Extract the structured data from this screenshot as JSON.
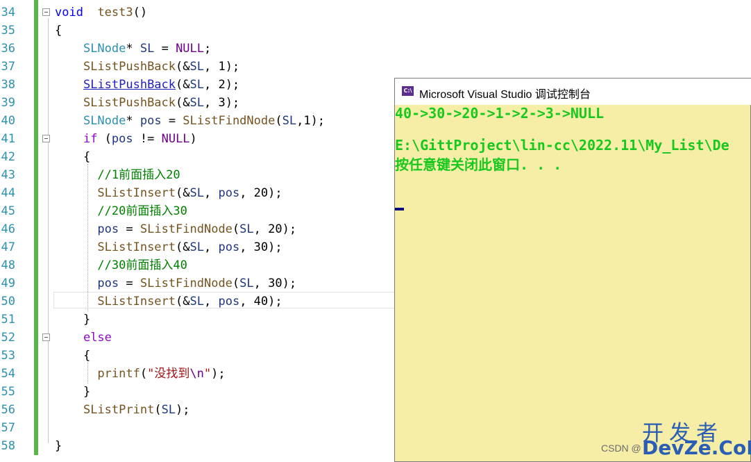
{
  "editor": {
    "lines": [
      {
        "num": "34",
        "parts": [
          [
            "kw",
            "void"
          ],
          [
            "",
            "  "
          ],
          [
            "fn",
            "test3"
          ],
          [
            "",
            "()"
          ]
        ]
      },
      {
        "num": "35",
        "parts": [
          [
            "",
            "{"
          ]
        ]
      },
      {
        "num": "36",
        "parts": [
          [
            "",
            "    "
          ],
          [
            "ty",
            "SLNode"
          ],
          [
            "",
            "* "
          ],
          [
            "var",
            "SL"
          ],
          [
            "",
            " = "
          ],
          [
            "mac",
            "NULL"
          ],
          [
            "",
            ";"
          ]
        ]
      },
      {
        "num": "37",
        "parts": [
          [
            "",
            "    "
          ],
          [
            "fn",
            "SListPushBack"
          ],
          [
            "",
            "(&"
          ],
          [
            "var",
            "SL"
          ],
          [
            "",
            ", 1);"
          ]
        ]
      },
      {
        "num": "38",
        "parts": [
          [
            "",
            "    "
          ],
          [
            "link",
            "SListPushBack"
          ],
          [
            "",
            "(&"
          ],
          [
            "var",
            "SL"
          ],
          [
            "",
            ", 2);"
          ]
        ]
      },
      {
        "num": "39",
        "parts": [
          [
            "",
            "    "
          ],
          [
            "fn",
            "SListPushBack"
          ],
          [
            "",
            "(&"
          ],
          [
            "var",
            "SL"
          ],
          [
            "",
            ", 3);"
          ]
        ]
      },
      {
        "num": "40",
        "parts": [
          [
            "",
            "    "
          ],
          [
            "ty",
            "SLNode"
          ],
          [
            "",
            "* "
          ],
          [
            "var",
            "pos"
          ],
          [
            "",
            " = "
          ],
          [
            "fn",
            "SListFindNode"
          ],
          [
            "",
            "("
          ],
          [
            "var",
            "SL"
          ],
          [
            "",
            ",1);"
          ]
        ]
      },
      {
        "num": "41",
        "parts": [
          [
            "",
            "    "
          ],
          [
            "kw2",
            "if"
          ],
          [
            "",
            " ("
          ],
          [
            "var",
            "pos"
          ],
          [
            "",
            " != "
          ],
          [
            "mac",
            "NULL"
          ],
          [
            "",
            ")"
          ]
        ]
      },
      {
        "num": "42",
        "parts": [
          [
            "",
            "    {"
          ]
        ]
      },
      {
        "num": "43",
        "parts": [
          [
            "",
            "      "
          ],
          [
            "cm",
            "//1前面插入20"
          ]
        ]
      },
      {
        "num": "44",
        "parts": [
          [
            "",
            "      "
          ],
          [
            "fn",
            "SListInsert"
          ],
          [
            "",
            "(&"
          ],
          [
            "var",
            "SL"
          ],
          [
            "",
            ", "
          ],
          [
            "var",
            "pos"
          ],
          [
            "",
            ", 20);"
          ]
        ]
      },
      {
        "num": "45",
        "parts": [
          [
            "",
            "      "
          ],
          [
            "cm",
            "//20前面插入30"
          ]
        ]
      },
      {
        "num": "46",
        "parts": [
          [
            "",
            "      "
          ],
          [
            "var",
            "pos"
          ],
          [
            "",
            " = "
          ],
          [
            "fn",
            "SListFindNode"
          ],
          [
            "",
            "("
          ],
          [
            "var",
            "SL"
          ],
          [
            "",
            ", 20);"
          ]
        ]
      },
      {
        "num": "47",
        "parts": [
          [
            "",
            "      "
          ],
          [
            "fn",
            "SListInsert"
          ],
          [
            "",
            "(&"
          ],
          [
            "var",
            "SL"
          ],
          [
            "",
            ", "
          ],
          [
            "var",
            "pos"
          ],
          [
            "",
            ", 30);"
          ]
        ]
      },
      {
        "num": "48",
        "parts": [
          [
            "",
            "      "
          ],
          [
            "cm",
            "//30前面插入40"
          ]
        ]
      },
      {
        "num": "49",
        "parts": [
          [
            "",
            "      "
          ],
          [
            "var",
            "pos"
          ],
          [
            "",
            " = "
          ],
          [
            "fn",
            "SListFindNode"
          ],
          [
            "",
            "("
          ],
          [
            "var",
            "SL"
          ],
          [
            "",
            ", 30);"
          ]
        ]
      },
      {
        "num": "50",
        "parts": [
          [
            "",
            "      "
          ],
          [
            "fn",
            "SListInsert"
          ],
          [
            "",
            "(&"
          ],
          [
            "var",
            "SL"
          ],
          [
            "",
            ", "
          ],
          [
            "var",
            "pos"
          ],
          [
            "",
            ", 40);"
          ]
        ]
      },
      {
        "num": "51",
        "parts": [
          [
            "",
            "    }"
          ]
        ]
      },
      {
        "num": "52",
        "parts": [
          [
            "",
            "    "
          ],
          [
            "kw2",
            "else"
          ]
        ]
      },
      {
        "num": "53",
        "parts": [
          [
            "",
            "    {"
          ]
        ]
      },
      {
        "num": "54",
        "parts": [
          [
            "",
            "      "
          ],
          [
            "fn",
            "printf"
          ],
          [
            "",
            "("
          ],
          [
            "str",
            "\"没找到"
          ],
          [
            "mac",
            "\\n"
          ],
          [
            "str",
            "\""
          ],
          [
            "",
            ");"
          ]
        ]
      },
      {
        "num": "55",
        "parts": [
          [
            "",
            "    }"
          ]
        ]
      },
      {
        "num": "56",
        "parts": [
          [
            "",
            "    "
          ],
          [
            "fn",
            "SListPrint"
          ],
          [
            "",
            "("
          ],
          [
            "var",
            "SL"
          ],
          [
            "",
            ");"
          ]
        ]
      },
      {
        "num": "57",
        "parts": [
          [
            "",
            ""
          ]
        ]
      },
      {
        "num": "58",
        "parts": [
          [
            "",
            "}"
          ]
        ]
      }
    ]
  },
  "console": {
    "icon_label": "C:\\",
    "title": "Microsoft Visual Studio 调试控制台",
    "output_lines": [
      "40->30->20->1->2->3->NULL",
      "",
      "E:\\GittProject\\lin-cc\\2022.11\\My_List\\De",
      "按任意键关闭此窗口. . ."
    ]
  },
  "watermark": {
    "site_cn": "开发者",
    "site_en": "DevZe.CoM",
    "csdn": "CSDN @"
  },
  "colors": {
    "console_bg": "#f6eea6",
    "console_text": "#19c81e",
    "line_number": "#2b91af",
    "change_bar": "#57b847"
  }
}
